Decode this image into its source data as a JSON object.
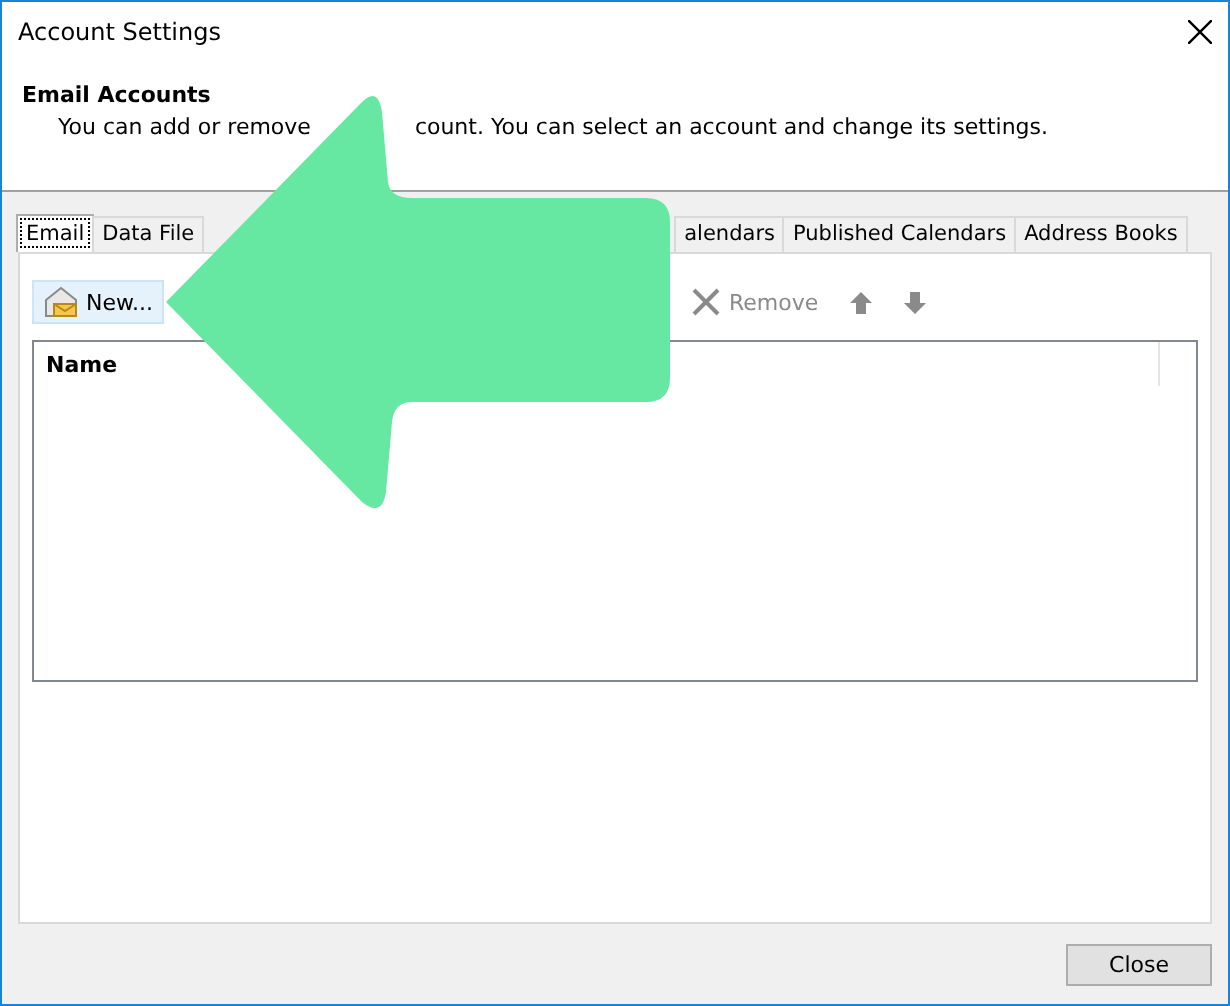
{
  "window": {
    "title": "Account Settings"
  },
  "header": {
    "title": "Email Accounts",
    "description_parts": [
      "You can add or remove",
      "count. You can select an account and change its settings."
    ]
  },
  "tabs": [
    {
      "label": "Email",
      "selected": true
    },
    {
      "label": "Data File",
      "selected": false
    },
    {
      "label": "alendars",
      "selected": false
    },
    {
      "label": "Published Calendars",
      "selected": false
    },
    {
      "label": "Address Books",
      "selected": false
    }
  ],
  "toolbar": [
    {
      "kind": "new",
      "label": "New...",
      "disabled": false
    },
    {
      "kind": "remove",
      "label": "Remove",
      "disabled": true
    },
    {
      "kind": "up",
      "disabled": true
    },
    {
      "kind": "down",
      "disabled": true
    }
  ],
  "list": {
    "columns": [
      "Name"
    ]
  },
  "buttons": [
    {
      "label": "Close"
    }
  ]
}
